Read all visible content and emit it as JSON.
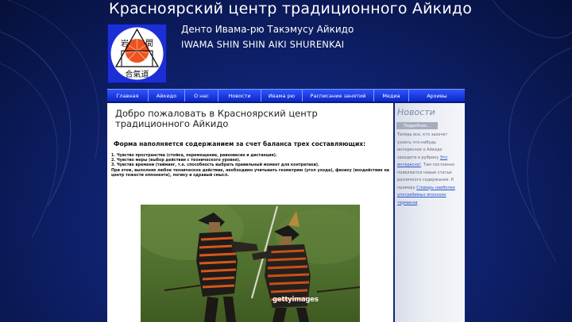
{
  "site": {
    "title": "Красноярский центр традиционного Айкидо",
    "subtitle_ru": "Денто Ивама-рю Такэмусу Айкидо",
    "subtitle_en": "IWAMA SHIN SHIN AIKI SHURENKAI"
  },
  "logo": {
    "top_left_char": "岩",
    "top_right_char": "間",
    "bottom_text": "合氣道"
  },
  "nav": {
    "items": [
      {
        "label": "Главная",
        "name": "nav-item-home"
      },
      {
        "label": "Айкидо",
        "name": "nav-item-aikido"
      },
      {
        "label": "О нас",
        "name": "nav-item-about"
      },
      {
        "label": "Новости",
        "name": "nav-item-news"
      },
      {
        "label": "Ивама рю",
        "name": "nav-item-iwama-ryu"
      },
      {
        "label": "Расписание занятий",
        "name": "nav-item-schedule"
      },
      {
        "label": "Медиа",
        "name": "nav-item-media"
      },
      {
        "label": "Архивы",
        "name": "nav-item-archives"
      }
    ]
  },
  "main": {
    "title": "Добро пожаловать в Красноярский центр традиционного Айкидо",
    "heading": "Форма наполняется содержанием за счет баланса трех составляющих:",
    "item1": "1. Чувство пространства (стойка, перемещение, равновесие и дистанция).",
    "item2": "2. Чувство меры (выбор действия с технического уровня).",
    "item3": "3. Чувство времени (тайминг, т.е. способность выбрать правильный момент для контратаки).",
    "paragraph": "При этом, выполняя любое техническое действие, необходимо учитывать геометрию (угол ухода), физику (воздействие на центр тяжести оппонента), логику и здравый смысл.",
    "photo_watermark": "gettyimages"
  },
  "sidebar": {
    "title": "Новости",
    "more_button": "Подробнее...",
    "text_before_link1": "Теперь все, кто захочет узнать что-нибудь интересное о Айкидо заходите в рубрику ",
    "link1": "Это интересно!",
    "text_after_link1": ". Там постоянно появляются новые статьи различного содержания. К примеру ",
    "link2": "Словарь наиболее употребимых японских терминов"
  },
  "colors": {
    "background": "#0f2270",
    "nav_bar": "#1f3fe6",
    "content_bg": "#ffffff",
    "sidebar_title": "#7a8aa8",
    "logo_sun": "#f0521e",
    "link": "#2a55c8"
  }
}
